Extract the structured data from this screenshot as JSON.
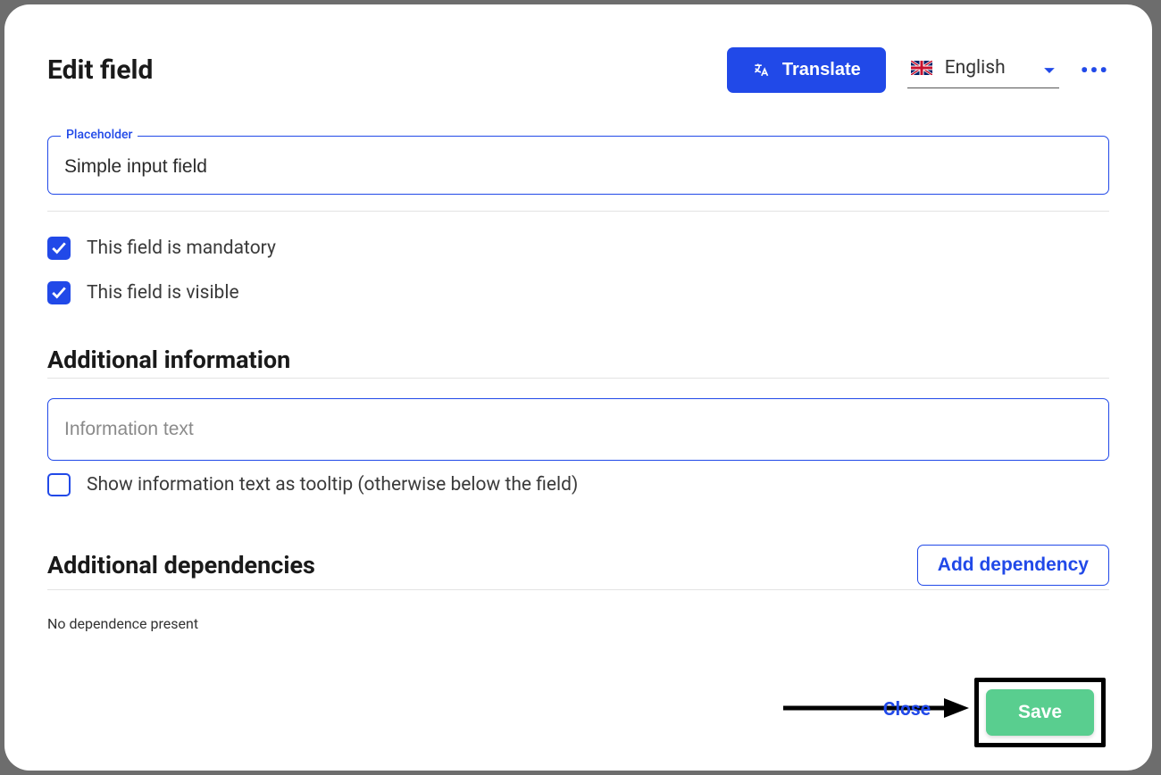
{
  "title": "Edit field",
  "translate_label": "Translate",
  "language": {
    "selected": "English"
  },
  "placeholder_field": {
    "label": "Placeholder",
    "value": "Simple input field"
  },
  "checkboxes": {
    "mandatory_label": "This field is mandatory",
    "visible_label": "This field is visible",
    "tooltip_label": "Show information text as tooltip (otherwise below the field)"
  },
  "sections": {
    "additional_info": "Additional information",
    "additional_deps": "Additional dependencies"
  },
  "info_input_placeholder": "Information text",
  "add_dependency_label": "Add dependency",
  "no_dependency_text": "No dependence present",
  "close_label": "Close",
  "save_label": "Save"
}
